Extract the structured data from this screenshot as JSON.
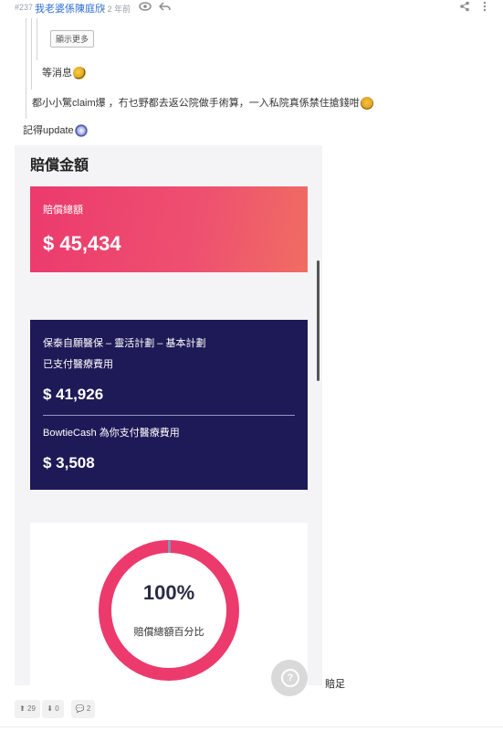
{
  "post": {
    "number": "#237",
    "author": "我老婆係陳庭欣",
    "separator": "•",
    "time": "2 年前"
  },
  "quote": {
    "show_more": "顯示更多",
    "line1": "等消息",
    "line2": "都小小驚claim爆 ，冇乜野都去返公院做手術算，一入私院真係禁住搶錢咁"
  },
  "message": {
    "line": "記得update"
  },
  "card": {
    "title": "賠償金額",
    "total_label": "賠償總額",
    "total_amount": "$ 45,434",
    "plan_name": "保泰自願醫保 – 靈活計劃 – 基本計劃",
    "paid_label": "已支付醫療費用",
    "paid_amount": "$ 41,926",
    "cash_label": "BowtieCash 為你支付醫療費用",
    "cash_amount": "$ 3,508",
    "percent": "100%",
    "percent_value": 100,
    "percent_label": "賠償總額百分比",
    "accent_pink": "#ec3a6d",
    "navy": "#1e1a57"
  },
  "after_text": "賠足",
  "footer": {
    "upvotes": "29",
    "downvotes": "0",
    "replies": "2"
  }
}
